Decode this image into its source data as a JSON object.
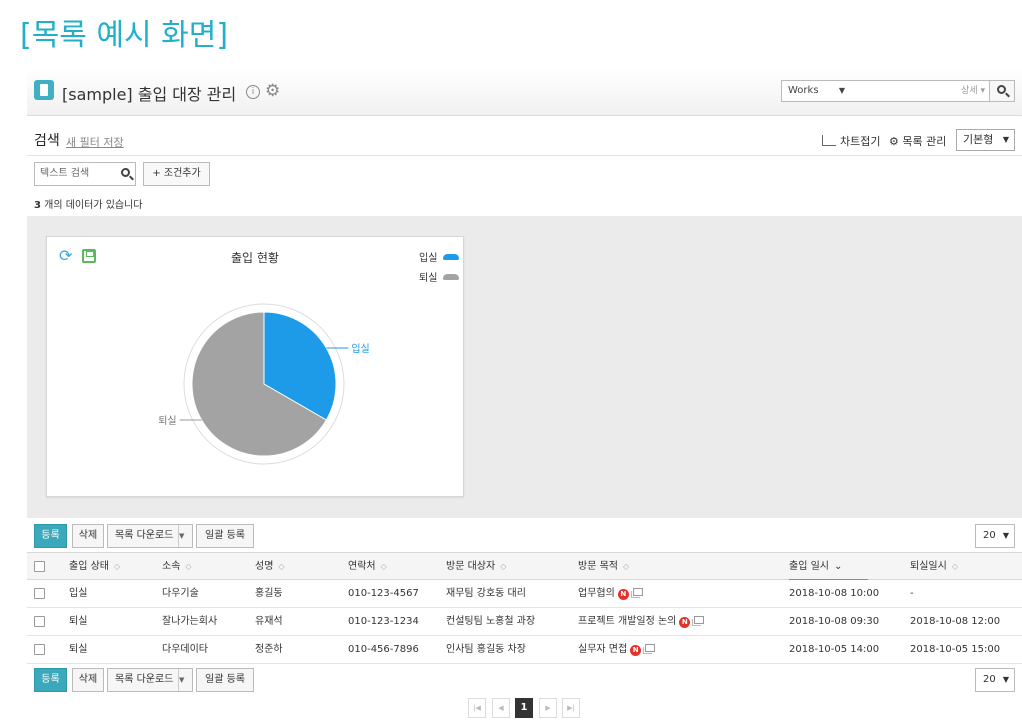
{
  "doc_title": "[목록 예시 화면]",
  "header": {
    "app_title": "[sample] 출입 대장 관리",
    "search_scope": "Works",
    "search_detail": "상세"
  },
  "filter": {
    "search_label": "검색",
    "save_filter": "새 필터 저장",
    "chart_toggle": "차트접기",
    "list_manage": "목록 관리",
    "view_type": "기본형",
    "text_search_placeholder": "텍스트 검색",
    "add_condition": "+ 조건추가"
  },
  "count": {
    "number": "3",
    "suffix": " 개의 데이터가 있습니다"
  },
  "chart_data": {
    "type": "pie",
    "title": "출입 현황",
    "categories": [
      "입실",
      "퇴실"
    ],
    "values": [
      1,
      2
    ],
    "colors": [
      "#1e9be8",
      "#a3a3a3"
    ],
    "legend_position": "top-right"
  },
  "toolbar": {
    "register": "등록",
    "delete": "삭제",
    "download": "목록 다운로드",
    "bulk_register": "일괄 등록",
    "page_size": "20"
  },
  "table": {
    "columns": [
      "출입 상태",
      "소속",
      "성명",
      "연락처",
      "방문 대상자",
      "방문 목적",
      "출입 일시",
      "퇴실일시"
    ],
    "rows": [
      [
        "입실",
        "다우기술",
        "홍길동",
        "010-123-4567",
        "재무팀 강호동 대리",
        "업무협의",
        "2018-10-08 10:00",
        "-"
      ],
      [
        "퇴실",
        "잘나가는회사",
        "유재석",
        "010-123-1234",
        "컨설팅팀 노홍철 과장",
        "프로젝트 개발일정 논의",
        "2018-10-08 09:30",
        "2018-10-08 12:00"
      ],
      [
        "퇴실",
        "다우데이타",
        "정준하",
        "010-456-7896",
        "인사팀 홍길동 차장",
        "실무자 면접",
        "2018-10-05 14:00",
        "2018-10-05 15:00"
      ]
    ],
    "new_badge": "N"
  },
  "pagination": {
    "current_page": "1"
  }
}
